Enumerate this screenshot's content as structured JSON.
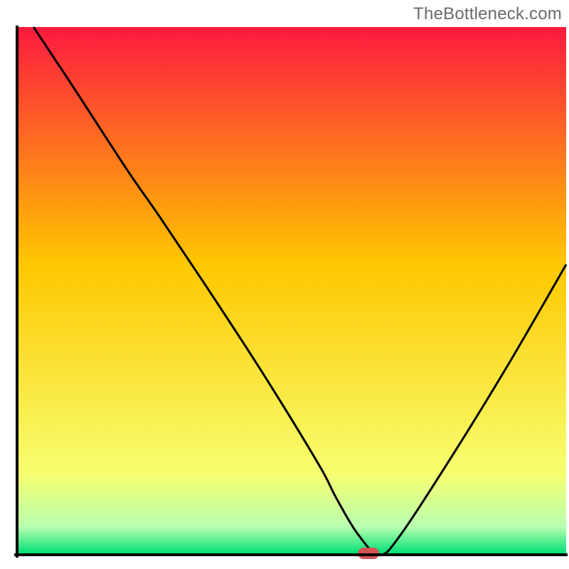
{
  "attribution": "TheBottleneck.com",
  "chart_data": {
    "type": "line",
    "title": "",
    "xlabel": "",
    "ylabel": "",
    "xlim": [
      0,
      100
    ],
    "ylim": [
      0,
      100
    ],
    "grid": false,
    "legend": false,
    "annotations": [],
    "series": [
      {
        "name": "curve",
        "x": [
          3,
          10,
          20,
          26,
          35,
          45,
          55,
          58,
          62,
          66,
          70,
          80,
          90,
          100
        ],
        "y": [
          100,
          89,
          73,
          64,
          50,
          34,
          17,
          11,
          4,
          0,
          4,
          20,
          37,
          55
        ]
      }
    ],
    "marker": {
      "x": 64,
      "y": 0
    },
    "background_gradient_top": "#fc1a3f",
    "background_gradient_mid": "#fec700",
    "background_gradient_low": "#f7ff70",
    "background_gradient_bottom": "#00e076",
    "axis_color": "#000000",
    "curve_color": "#000000",
    "marker_color": "#d65353"
  }
}
